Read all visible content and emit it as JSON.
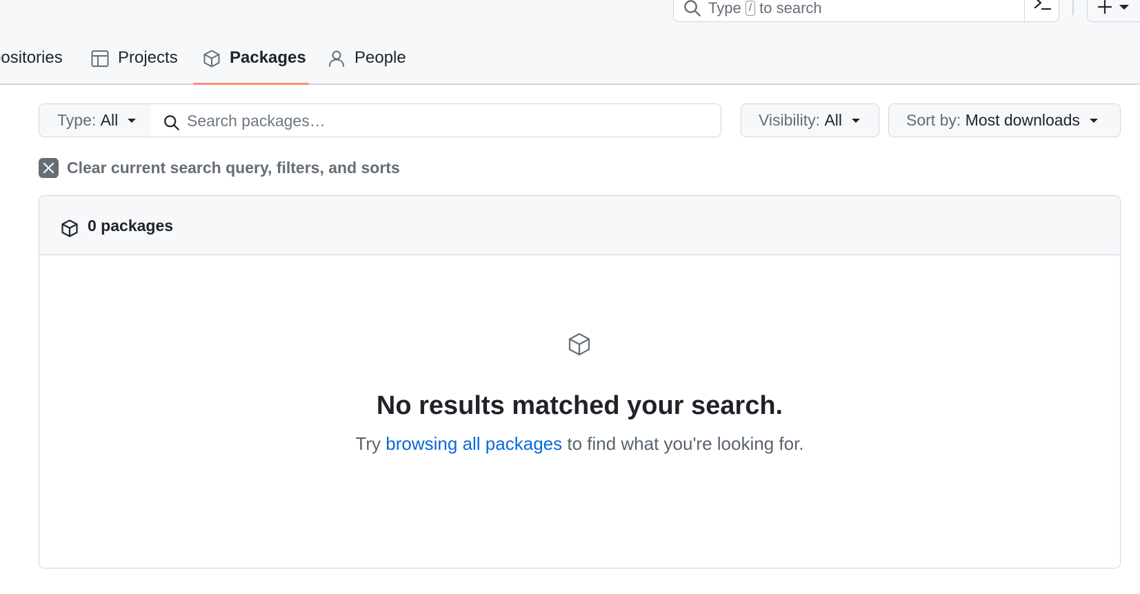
{
  "header": {
    "search": {
      "prefix": "Type",
      "key": "/",
      "suffix": "to search"
    }
  },
  "tabs": [
    {
      "label": "Repositories",
      "visible_label": "positories",
      "selected": false
    },
    {
      "label": "Projects",
      "selected": false
    },
    {
      "label": "Packages",
      "selected": true
    },
    {
      "label": "People",
      "selected": false
    }
  ],
  "filters": {
    "type": {
      "label": "Type:",
      "value": "All"
    },
    "search": {
      "placeholder": "Search packages…",
      "value": ""
    },
    "visibility": {
      "label": "Visibility:",
      "value": "All"
    },
    "sort": {
      "label": "Sort by:",
      "value": "Most downloads"
    }
  },
  "clear": {
    "text": "Clear current search query, filters, and sorts"
  },
  "results": {
    "count_label": "0 packages",
    "empty_title": "No results matched your search.",
    "empty_prefix": "Try",
    "empty_link": "browsing all packages",
    "empty_suffix": "to find what you're looking for."
  },
  "colors": {
    "accent_link": "#0969da",
    "tab_underline": "#fd8c73",
    "header_bg": "#f6f8fa",
    "border": "#d0d7de"
  },
  "icons": {
    "global_search": "search-icon",
    "command": "command-palette-icon",
    "create": "plus-icon",
    "projects": "table-icon",
    "packages": "package-icon",
    "people": "person-icon",
    "clear": "x-icon"
  }
}
